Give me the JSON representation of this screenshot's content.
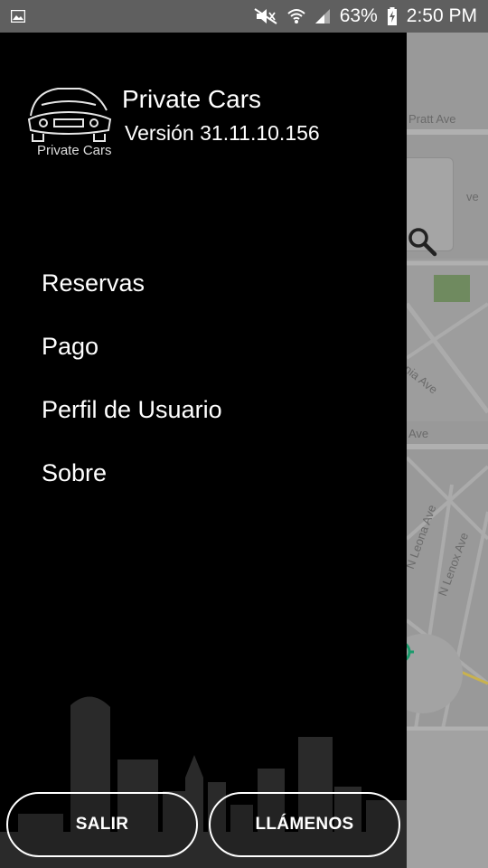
{
  "status_bar": {
    "battery": "63%",
    "time": "2:50 PM",
    "icons": [
      "image-icon",
      "mute-icon",
      "wifi-icon",
      "signal-icon",
      "battery-charging-icon"
    ]
  },
  "drawer": {
    "logo_text": "Private Cars",
    "app_name": "Private Cars",
    "version": "Versión 31.11.10.156",
    "menu": [
      {
        "label": "Reservas"
      },
      {
        "label": "Pago"
      },
      {
        "label": "Perfil de Usuario"
      },
      {
        "label": "Sobre"
      }
    ],
    "buttons": {
      "exit": "SALIR",
      "call": "LLÁMENOS"
    }
  },
  "map": {
    "labels": [
      "Pratt Ave",
      "ve",
      "onia Ave",
      "Ave",
      "N Leona Ave",
      "N Lenox Ave",
      "Le"
    ],
    "accent_color": "#1a9b6c"
  }
}
